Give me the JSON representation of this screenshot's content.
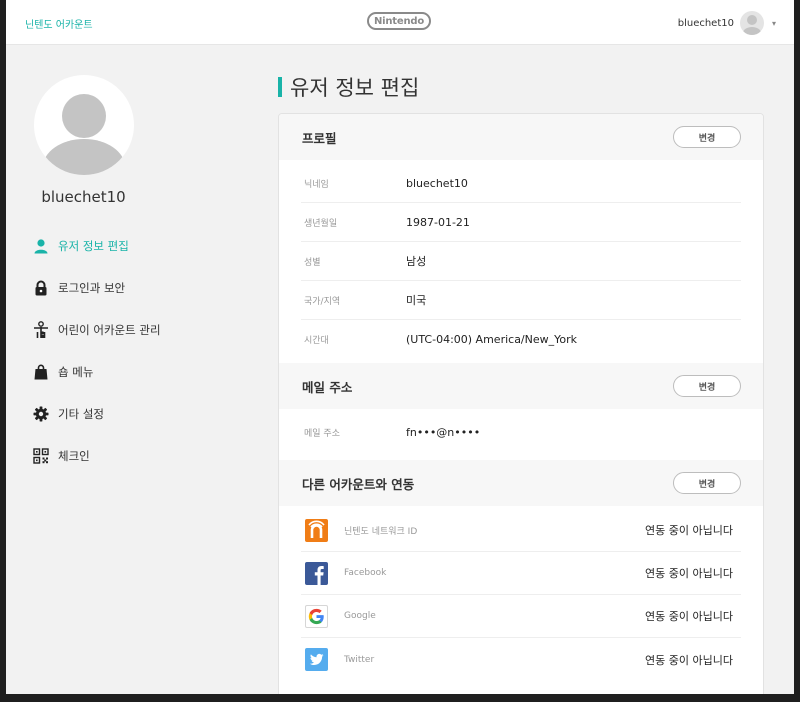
{
  "header": {
    "brand": "닌텐도 어카운트",
    "logo": "Nintendo",
    "username": "bluechet10",
    "caret": "▾"
  },
  "sidebar": {
    "nickname": "bluechet10",
    "items": [
      {
        "label": "유저 정보 편집",
        "icon": "person-icon",
        "active": true
      },
      {
        "label": "로그인과 보안",
        "icon": "lock-icon"
      },
      {
        "label": "어린이 어카운트 관리",
        "icon": "child-account-icon"
      },
      {
        "label": "숍 메뉴",
        "icon": "shopping-bag-icon"
      },
      {
        "label": "기타 설정",
        "icon": "gear-icon"
      },
      {
        "label": "체크인",
        "icon": "qr-code-icon"
      }
    ]
  },
  "main": {
    "title": "유저 정보 편집",
    "profile": {
      "heading": "프로필",
      "change_label": "변경",
      "rows": [
        {
          "key": "닉네임",
          "value": "bluechet10"
        },
        {
          "key": "생년월일",
          "value": "1987-01-21"
        },
        {
          "key": "성별",
          "value": "남성"
        },
        {
          "key": "국가/지역",
          "value": "미국"
        },
        {
          "key": "시간대",
          "value": "(UTC-04:00) America/New_York"
        }
      ]
    },
    "email": {
      "heading": "메일 주소",
      "change_label": "변경",
      "rows": [
        {
          "key": "메일 주소",
          "value": "fn•••@n••••"
        }
      ]
    },
    "links": {
      "heading": "다른 어카운트와 연동",
      "change_label": "변경",
      "services": [
        {
          "name": "닌텐도 네트워크 ID",
          "status": "연동 중이 아닙니다",
          "icon": "nintendo-network-icon",
          "color": "#f07d16"
        },
        {
          "name": "Facebook",
          "status": "연동 중이 아닙니다",
          "icon": "facebook-icon",
          "color": "#3b5998"
        },
        {
          "name": "Google",
          "status": "연동 중이 아닙니다",
          "icon": "google-icon",
          "color": "#ffffff"
        },
        {
          "name": "Twitter",
          "status": "연동 중이 아닙니다",
          "icon": "twitter-icon",
          "color": "#55acee"
        }
      ]
    }
  },
  "colors": {
    "accent": "#19b3a8",
    "background": "#f2f2f2"
  }
}
